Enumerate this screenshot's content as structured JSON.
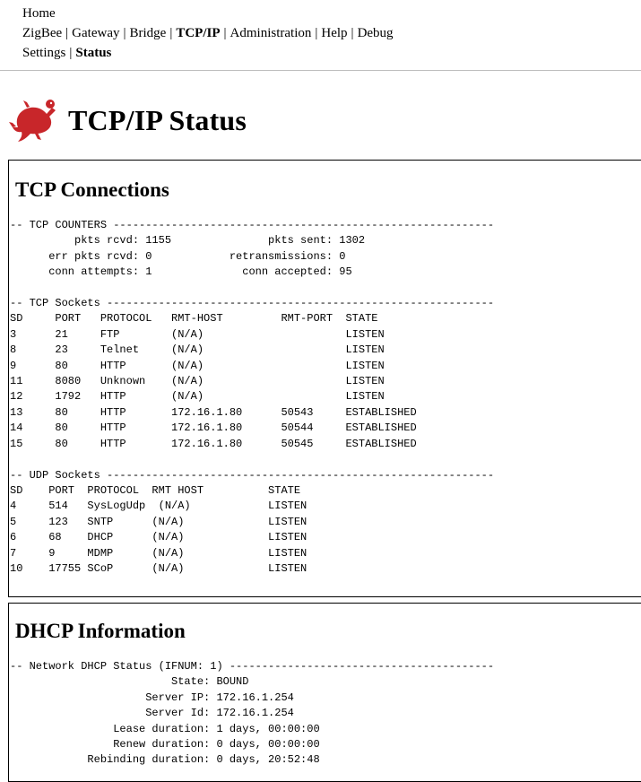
{
  "nav": {
    "home": "Home",
    "row1": [
      "ZigBee",
      "Gateway",
      "Bridge",
      "TCP/IP",
      "Administration",
      "Help",
      "Debug"
    ],
    "row1_active": "TCP/IP",
    "row2": [
      "Settings",
      "Status"
    ],
    "row2_active": "Status",
    "separator": "|"
  },
  "page": {
    "title": "TCP/IP Status",
    "logo_icon": "red-lizard-logo",
    "accent_color": "#c8262a"
  },
  "tcp": {
    "heading": "TCP Connections",
    "text": "-- TCP COUNTERS -----------------------------------------------------------\n          pkts rcvd: 1155               pkts sent: 1302\n      err pkts rcvd: 0            retransmissions: 0\n      conn attempts: 1              conn accepted: 95\n\n-- TCP Sockets ------------------------------------------------------------\nSD     PORT   PROTOCOL   RMT-HOST         RMT-PORT  STATE\n3      21     FTP        (N/A)                      LISTEN\n8      23     Telnet     (N/A)                      LISTEN\n9      80     HTTP       (N/A)                      LISTEN\n11     8080   Unknown    (N/A)                      LISTEN\n12     1792   HTTP       (N/A)                      LISTEN\n13     80     HTTP       172.16.1.80      50543     ESTABLISHED\n14     80     HTTP       172.16.1.80      50544     ESTABLISHED\n15     80     HTTP       172.16.1.80      50545     ESTABLISHED\n\n-- UDP Sockets ------------------------------------------------------------\nSD    PORT  PROTOCOL  RMT HOST          STATE\n4     514   SysLogUdp  (N/A)            LISTEN\n5     123   SNTP      (N/A)             LISTEN\n6     68    DHCP      (N/A)             LISTEN\n7     9     MDMP      (N/A)             LISTEN\n10    17755 SCoP      (N/A)             LISTEN"
  },
  "dhcp": {
    "heading": "DHCP Information",
    "text": "-- Network DHCP Status (IFNUM: 1) -----------------------------------------\n                         State: BOUND\n                     Server IP: 172.16.1.254\n                     Server Id: 172.16.1.254\n                Lease duration: 1 days, 00:00:00\n                Renew duration: 0 days, 00:00:00\n            Rebinding duration: 0 days, 20:52:48"
  }
}
